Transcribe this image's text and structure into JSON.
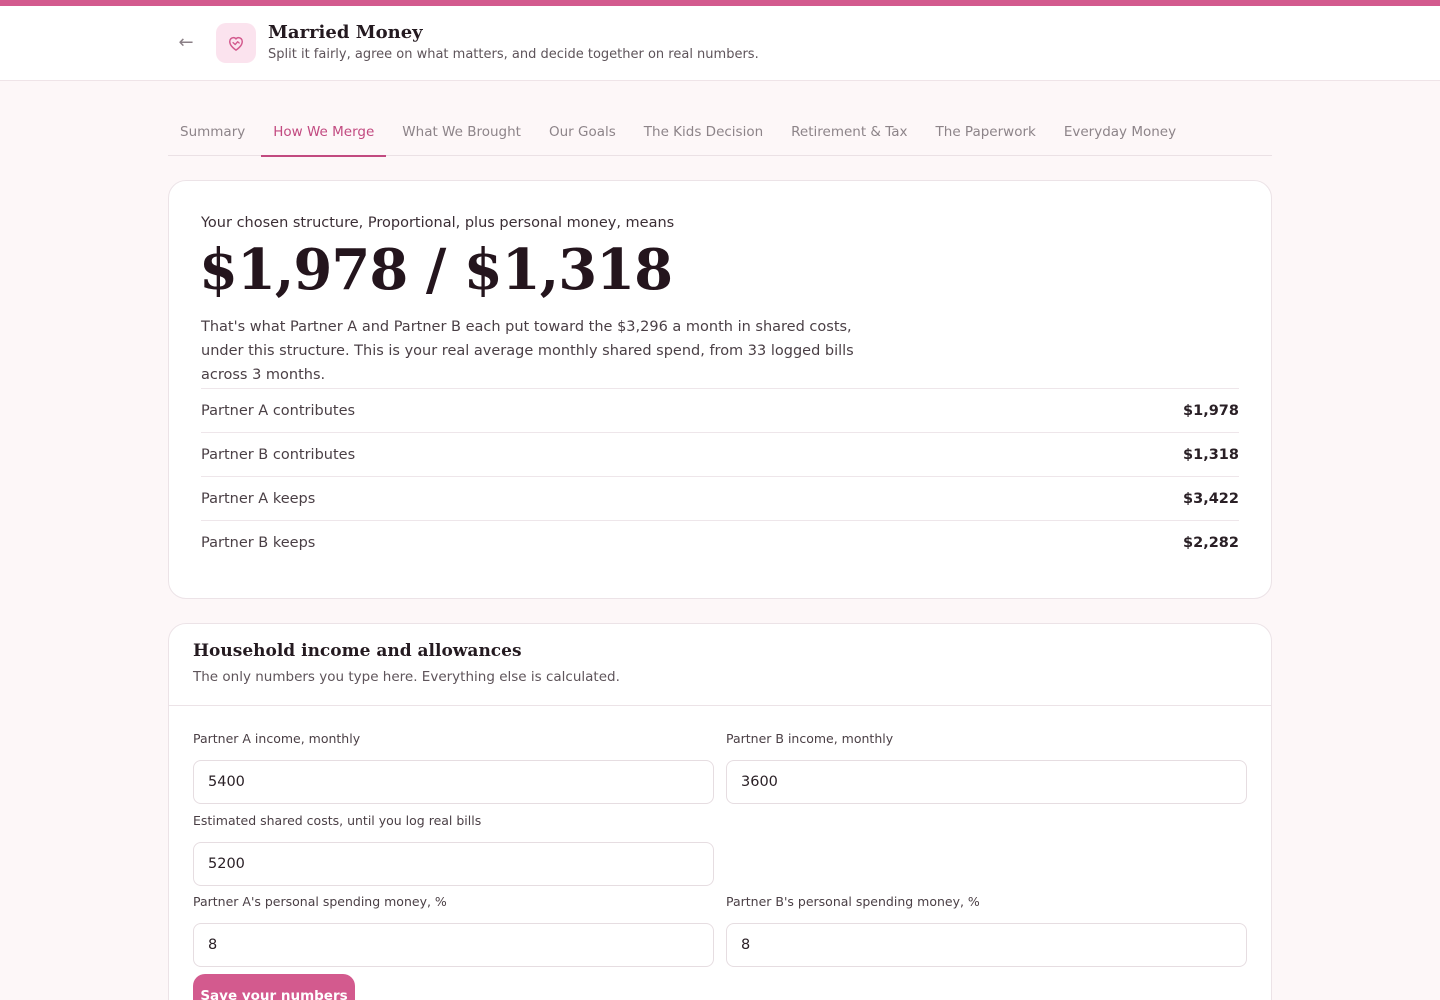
{
  "header": {
    "title": "Married Money",
    "subtitle": "Split it fairly, agree on what matters, and decide together on real numbers."
  },
  "tabs": [
    {
      "label": "Summary",
      "active": false
    },
    {
      "label": "How We Merge",
      "active": true
    },
    {
      "label": "What We Brought",
      "active": false
    },
    {
      "label": "Our Goals",
      "active": false
    },
    {
      "label": "The Kids Decision",
      "active": false
    },
    {
      "label": "Retirement & Tax",
      "active": false
    },
    {
      "label": "The Paperwork",
      "active": false
    },
    {
      "label": "Everyday Money",
      "active": false
    }
  ],
  "summary": {
    "intro": "Your chosen structure, Proportional, plus personal money, means",
    "figure": "$1,978 / $1,318",
    "explanation": "That's what Partner A and Partner B each put toward the $3,296 a month in shared costs, under this structure. This is your real average monthly shared spend, from 33 logged bills across 3 months.",
    "rows": [
      {
        "label": "Partner A contributes",
        "value": "$1,978"
      },
      {
        "label": "Partner B contributes",
        "value": "$1,318"
      },
      {
        "label": "Partner A keeps",
        "value": "$3,422"
      },
      {
        "label": "Partner B keeps",
        "value": "$2,282"
      }
    ]
  },
  "income": {
    "title": "Household income and allowances",
    "subtitle": "The only numbers you type here. Everything else is calculated.",
    "partner_a_income": {
      "label": "Partner A income, monthly",
      "value": "5400"
    },
    "partner_b_income": {
      "label": "Partner B income, monthly",
      "value": "3600"
    },
    "shared_costs": {
      "label": "Estimated shared costs, until you log real bills",
      "value": "5200"
    },
    "partner_a_personal": {
      "label": "Partner A's personal spending money, %",
      "value": "8"
    },
    "partner_b_personal": {
      "label": "Partner B's personal spending money, %",
      "value": "8"
    },
    "save_label": "Save your numbers"
  },
  "colors": {
    "accent": "#d35a8e",
    "active_tab": "#c24a80",
    "background": "#fdf7f8"
  },
  "icons": {
    "back": "arrow-left-icon",
    "logo": "heart-icon"
  }
}
